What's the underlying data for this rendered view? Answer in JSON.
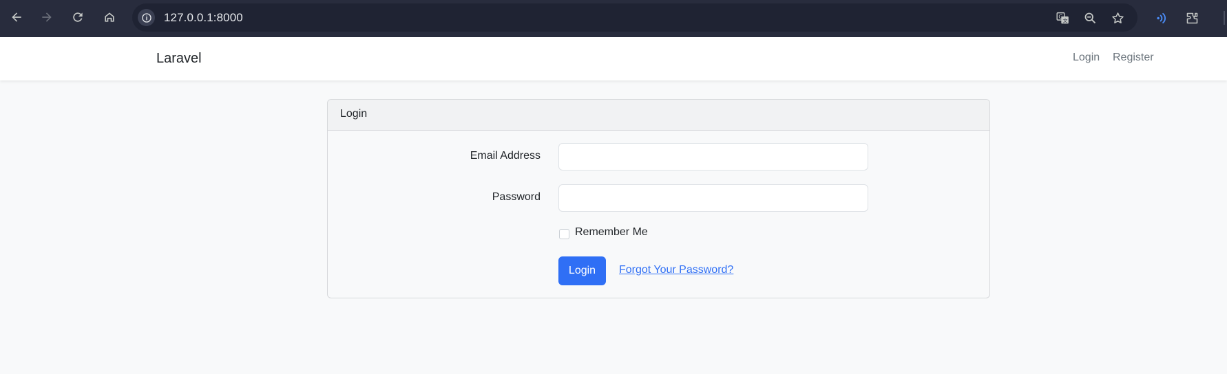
{
  "browser": {
    "url": "127.0.0.1:8000",
    "icons": [
      "back-icon",
      "forward-icon",
      "reload-icon",
      "home-icon",
      "site-info-icon",
      "translate-icon",
      "zoom-out-icon",
      "star-icon",
      "read-aloud-icon",
      "extensions-icon"
    ]
  },
  "navbar": {
    "brand": "Laravel",
    "links": [
      "Login",
      "Register"
    ]
  },
  "card": {
    "title": "Login",
    "email_label": "Email Address",
    "email_value": "",
    "password_label": "Password",
    "password_value": "",
    "remember_label": "Remember Me",
    "remember_checked": false,
    "submit_label": "Login",
    "forgot_label": "Forgot Your Password?"
  },
  "colors": {
    "chrome_bg": "#282c3d",
    "omnibox_bg": "#1f2333",
    "primary": "#2f6ff5",
    "page_bg": "#f8f9fa"
  }
}
